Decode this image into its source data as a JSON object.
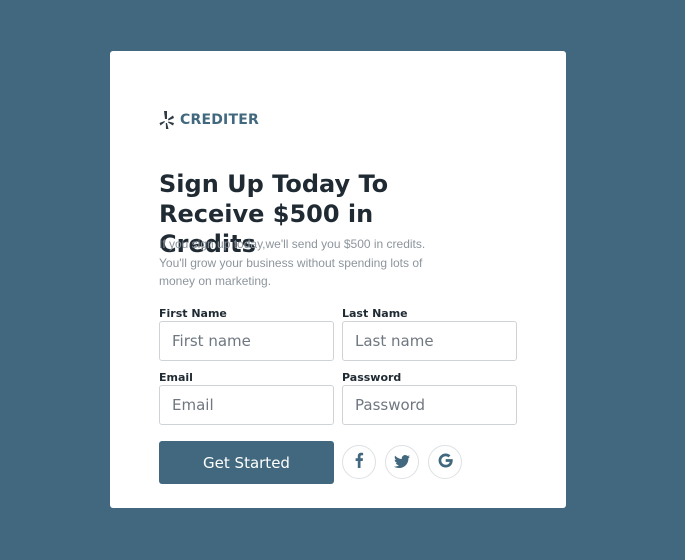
{
  "brand": {
    "name": "CREDITER",
    "logo_icon": "yelp-burst-icon"
  },
  "heading": {
    "line1": "Sign Up Today To",
    "line2": "Receive $500 in Credits"
  },
  "subtitle": {
    "line1": "If you sign up today,we'll send you $500 in credits.",
    "line2": "You'll grow your business without spending lots of",
    "line3": "money on marketing."
  },
  "form": {
    "first_name": {
      "label": "First Name",
      "placeholder": "First name"
    },
    "last_name": {
      "label": "Last Name",
      "placeholder": "Last name"
    },
    "email": {
      "label": "Email",
      "placeholder": "Email"
    },
    "password": {
      "label": "Password",
      "placeholder": "Password"
    },
    "submit_label": "Get Started"
  },
  "social": [
    {
      "icon": "facebook-icon"
    },
    {
      "icon": "twitter-icon"
    },
    {
      "icon": "google-icon"
    }
  ],
  "colors": {
    "background": "#41687e",
    "accent": "#41687e",
    "card": "#ffffff",
    "heading": "#1f2a33",
    "muted": "#8d959c"
  }
}
